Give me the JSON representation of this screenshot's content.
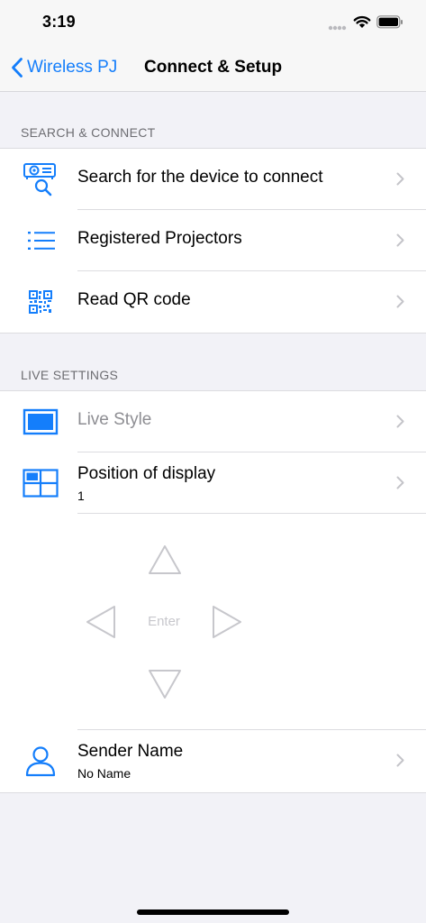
{
  "status_bar": {
    "time": "3:19"
  },
  "nav": {
    "back_label": "Wireless PJ",
    "title": "Connect & Setup"
  },
  "sections": {
    "search_connect": {
      "header": "SEARCH & CONNECT",
      "items": [
        {
          "label": "Search for the device to connect",
          "icon": "projector-search-icon"
        },
        {
          "label": "Registered Projectors",
          "icon": "list-icon"
        },
        {
          "label": "Read QR code",
          "icon": "qr-code-icon"
        }
      ]
    },
    "live_settings": {
      "header": "LIVE SETTINGS",
      "items": [
        {
          "label": "Live Style",
          "icon": "screen-icon",
          "disabled": true
        },
        {
          "label": "Position of display",
          "value": "1",
          "icon": "grid-layout-icon"
        }
      ]
    }
  },
  "dpad": {
    "enter_label": "Enter"
  },
  "sender": {
    "label": "Sender Name",
    "value": "No Name",
    "icon": "person-icon"
  },
  "colors": {
    "accent": "#147efb",
    "background": "#f2f2f7",
    "disabled_text": "#8e8e93",
    "dpad": "#c7c7cc"
  }
}
